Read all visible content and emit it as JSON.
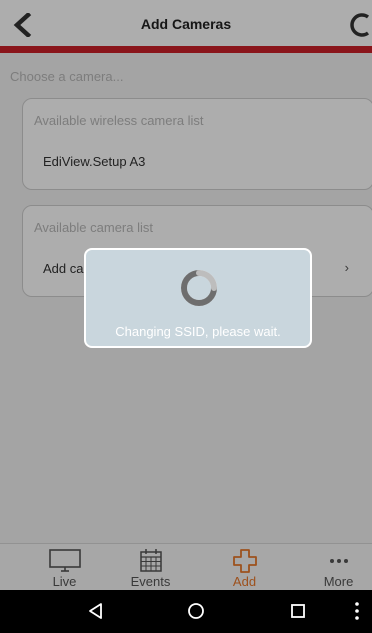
{
  "header": {
    "title": "Add Cameras",
    "back_icon": "chevron-left-icon",
    "refresh_icon": "refresh-icon",
    "accent_color": "#cc2028"
  },
  "main": {
    "subtitle": "Choose a camera...",
    "wireless_list": {
      "title": "Available wireless camera list",
      "items": [
        "EdiView.Setup A3"
      ]
    },
    "camera_list": {
      "title": "Available camera list",
      "item_label": "Add camera",
      "item_visible_text": "Add ca",
      "chevron": "›"
    }
  },
  "dialog": {
    "message": "Changing SSID, please wait.",
    "icon": "spinner-icon"
  },
  "tabbar": {
    "active_color": "#e8782b",
    "tabs": [
      {
        "label": "Live",
        "icon": "monitor-icon"
      },
      {
        "label": "Events",
        "icon": "calendar-icon"
      },
      {
        "label": "Add",
        "icon": "plus-icon"
      },
      {
        "label": "More",
        "icon": "more-icon"
      }
    ]
  },
  "system_nav": {
    "back": "back-triangle-icon",
    "home": "home-circle-icon",
    "recents": "recents-square-icon",
    "menu": "menu-dots-icon"
  }
}
